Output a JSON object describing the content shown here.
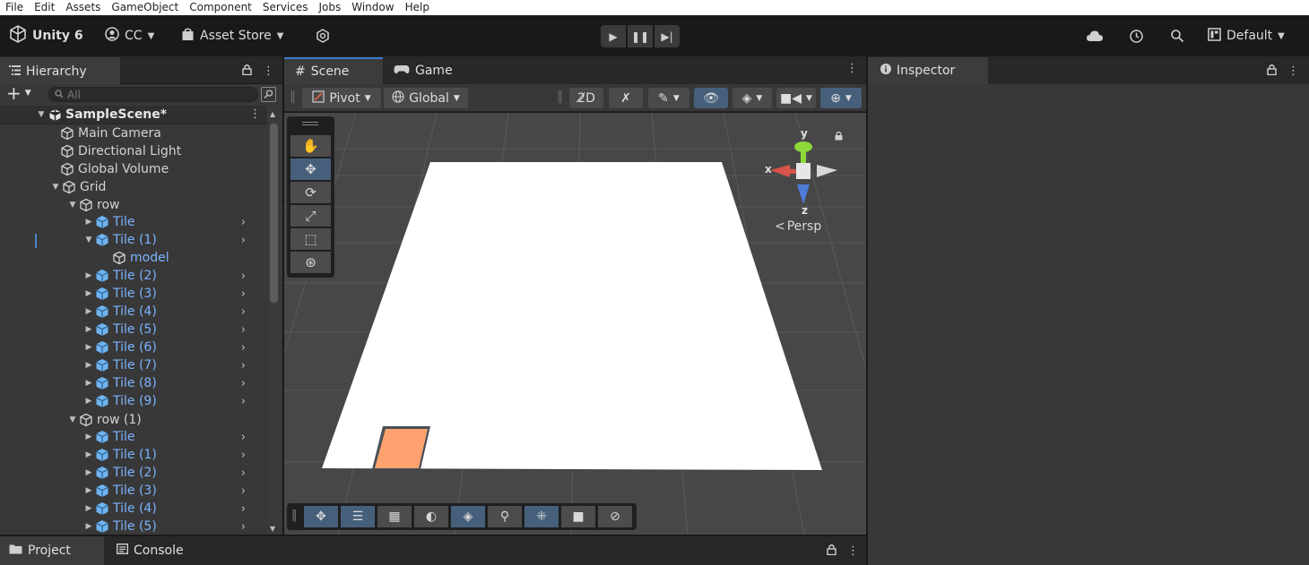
{
  "menu": [
    "File",
    "Edit",
    "Assets",
    "GameObject",
    "Component",
    "Services",
    "Jobs",
    "Window",
    "Help"
  ],
  "toolbar": {
    "unity_label": "Unity 6",
    "account_label": "CC",
    "asset_store_label": "Asset Store",
    "layout_label": "Default"
  },
  "hierarchy": {
    "tab_label": "Hierarchy",
    "search_placeholder": "All",
    "scene_name": "SampleScene*",
    "items": [
      {
        "label": "Main Camera",
        "kind": "object"
      },
      {
        "label": "Directional Light",
        "kind": "object"
      },
      {
        "label": "Global Volume",
        "kind": "object"
      },
      {
        "label": "Grid",
        "kind": "object"
      },
      {
        "label": "row",
        "kind": "object"
      },
      {
        "label": "Tile",
        "kind": "prefab"
      },
      {
        "label": "Tile (1)",
        "kind": "prefab"
      },
      {
        "label": "model",
        "kind": "prefab-child"
      },
      {
        "label": "Tile (2)",
        "kind": "prefab"
      },
      {
        "label": "Tile (3)",
        "kind": "prefab"
      },
      {
        "label": "Tile (4)",
        "kind": "prefab"
      },
      {
        "label": "Tile (5)",
        "kind": "prefab"
      },
      {
        "label": "Tile (6)",
        "kind": "prefab"
      },
      {
        "label": "Tile (7)",
        "kind": "prefab"
      },
      {
        "label": "Tile (8)",
        "kind": "prefab"
      },
      {
        "label": "Tile (9)",
        "kind": "prefab"
      },
      {
        "label": "row (1)",
        "kind": "object"
      },
      {
        "label": "Tile",
        "kind": "prefab"
      },
      {
        "label": "Tile (1)",
        "kind": "prefab"
      },
      {
        "label": "Tile (2)",
        "kind": "prefab"
      },
      {
        "label": "Tile (3)",
        "kind": "prefab"
      },
      {
        "label": "Tile (4)",
        "kind": "prefab"
      },
      {
        "label": "Tile (5)",
        "kind": "prefab"
      }
    ]
  },
  "scene": {
    "tab_label": "Scene",
    "game_tab_label": "Game",
    "pivot_label": "Pivot",
    "global_label": "Global",
    "gizmo_y": "y",
    "gizmo_x": "x",
    "gizmo_z": "z",
    "persp_label": "Persp",
    "plane_color": "#ffffff",
    "tile_color": "#ffa270"
  },
  "inspector": {
    "tab_label": "Inspector"
  },
  "bottom": {
    "project_label": "Project",
    "console_label": "Console"
  },
  "colors": {
    "accent": "#46607c",
    "prefab_text": "#7cb3ff"
  }
}
